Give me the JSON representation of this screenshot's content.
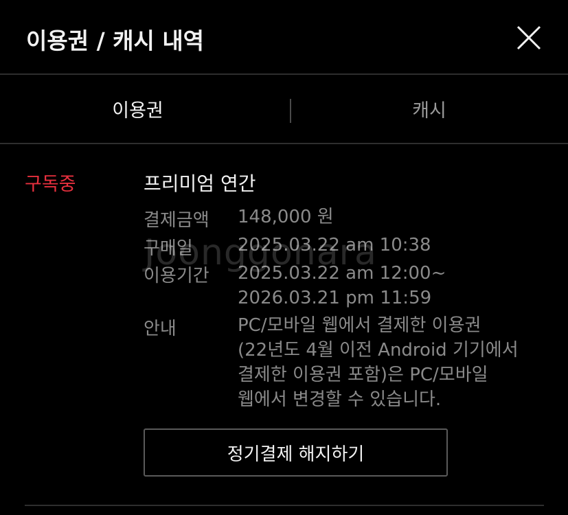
{
  "header": {
    "title": "이용권 / 캐시 내역"
  },
  "icons": {
    "close": "close-icon"
  },
  "tabs": [
    {
      "label": "이용권",
      "active": true
    },
    {
      "label": "캐시",
      "active": false
    }
  ],
  "subscription": {
    "status": "구독중",
    "plan_name": "프리미엄 연간",
    "payment_label": "결제금액",
    "payment_value": "148,000 원",
    "purchase_label": "구매일",
    "purchase_value": "2025.03.22 am 10:38",
    "period_label": "이용기간",
    "period_start": "2025.03.22 am 12:00~",
    "period_end": "2026.03.21 pm 11:59",
    "notice_label": "안내",
    "notice_lines": [
      "PC/모바일 웹에서 결제한 이용권",
      "(22년도 4월 이전 Android 기기에서",
      "결제한 이용권 포함)은 PC/모바일",
      "웹에서 변경할 수 있습니다."
    ],
    "cancel_button": "정기결제 해지하기"
  },
  "watermark": "Joonggonara",
  "colors": {
    "background": "#000000",
    "status_red": "#e8303e",
    "text_primary": "#f2f2f2",
    "text_secondary": "#8a8a8a"
  }
}
